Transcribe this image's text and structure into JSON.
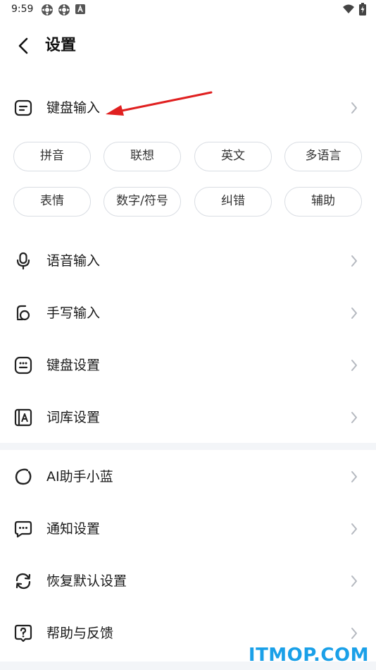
{
  "status_bar": {
    "time": "9:59",
    "icons_left": [
      "gear-badge-icon",
      "gear-badge-icon",
      "a-badge-icon"
    ],
    "icons_right": [
      "wifi-icon",
      "battery-charging-icon"
    ]
  },
  "header": {
    "title": "设置",
    "back_icon": "chevron-left-icon"
  },
  "keyboard_section": {
    "label": "键盘输入",
    "icon": "keyboard-input-icon",
    "chips": [
      "拼音",
      "联想",
      "英文",
      "多语言",
      "表情",
      "数字/符号",
      "纠错",
      "辅助"
    ]
  },
  "settings_items": [
    {
      "label": "语音输入",
      "icon": "microphone-icon"
    },
    {
      "label": "手写输入",
      "icon": "handwriting-icon"
    },
    {
      "label": "键盘设置",
      "icon": "keyboard-grid-icon"
    },
    {
      "label": "词库设置",
      "icon": "dictionary-icon"
    }
  ],
  "more_items": [
    {
      "label": "AI助手小蓝",
      "icon": "ai-assistant-icon"
    },
    {
      "label": "通知设置",
      "icon": "notification-icon"
    },
    {
      "label": "恢复默认设置",
      "icon": "restore-icon"
    },
    {
      "label": "帮助与反馈",
      "icon": "help-icon"
    }
  ],
  "annotation": {
    "color": "#e02020"
  },
  "watermark": "ITMOP.COM",
  "colors": {
    "accent": "#1aa0e8",
    "chip_border": "#d9dde3",
    "divider": "#f3f5f8"
  }
}
